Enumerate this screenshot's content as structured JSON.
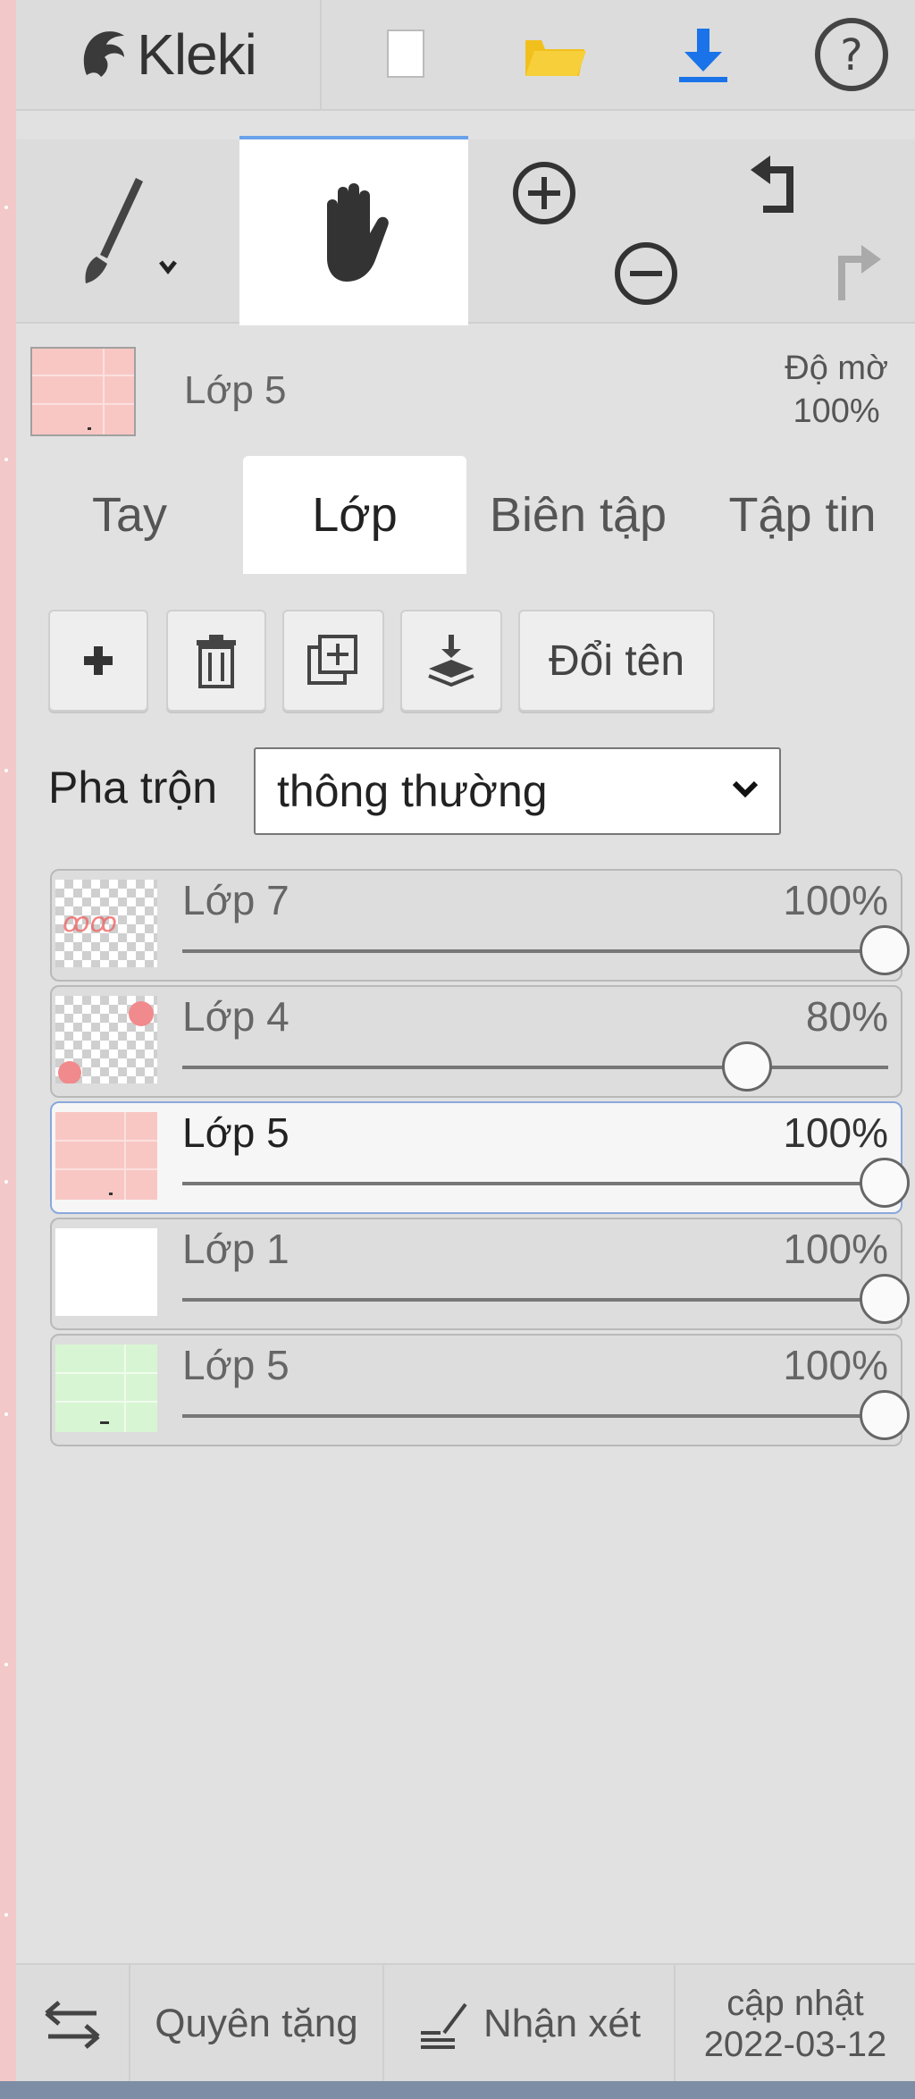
{
  "app": {
    "logo_text": "Kleki"
  },
  "topbar": {
    "buttons": [
      {
        "icon": "new-document-icon"
      },
      {
        "icon": "folder-icon",
        "color": "#f2c01c"
      },
      {
        "icon": "download-icon",
        "color": "#1a73e8"
      },
      {
        "icon": "help-icon"
      }
    ]
  },
  "tools": {
    "items": [
      {
        "icon": "brush-icon"
      },
      {
        "icon": "hand-icon",
        "active": true
      },
      {
        "icon": "zoom-in-icon"
      },
      {
        "icon": "zoom-out-icon"
      },
      {
        "icon": "undo-icon"
      },
      {
        "icon": "redo-icon"
      }
    ]
  },
  "current_layer": {
    "name": "Lớp 5",
    "opacity_label": "Độ mờ",
    "opacity_value": "100%"
  },
  "tabs": [
    {
      "label": "Tay"
    },
    {
      "label": "Lớp",
      "active": true
    },
    {
      "label": "Biên tập"
    },
    {
      "label": "Tập tin"
    }
  ],
  "layer_actions": {
    "add_icon": "plus-icon",
    "delete_icon": "trash-icon",
    "duplicate_icon": "duplicate-icon",
    "merge_icon": "merge-down-icon",
    "rename_label": "Đổi tên"
  },
  "blend": {
    "label": "Pha trộn",
    "value": "thông thường"
  },
  "layers": [
    {
      "name": "Lớp 7",
      "opacity": "100%",
      "level": 1.0
    },
    {
      "name": "Lớp 4",
      "opacity": "80%",
      "level": 0.8
    },
    {
      "name": "Lớp 5",
      "opacity": "100%",
      "level": 1.0,
      "active": true
    },
    {
      "name": "Lớp 1",
      "opacity": "100%",
      "level": 1.0
    },
    {
      "name": "Lớp 5",
      "opacity": "100%",
      "level": 1.0
    }
  ],
  "bottombar": {
    "swap_icon": "swap-icon",
    "donate_label": "Quyên tặng",
    "feedback_label": "Nhận xét",
    "updated_label": "cập nhật",
    "updated_date": "2022-03-12"
  }
}
